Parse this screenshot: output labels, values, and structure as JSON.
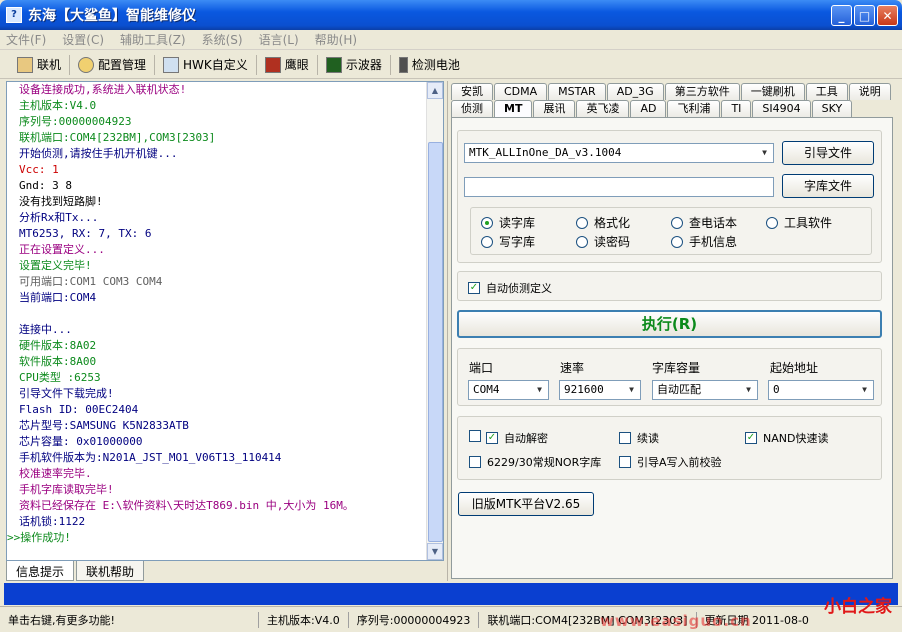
{
  "window": {
    "title": "东海【大鲨鱼】智能维修仪"
  },
  "menu": [
    "文件(F)",
    "设置(C)",
    "辅助工具(Z)",
    "系统(S)",
    "语言(L)",
    "帮助(H)"
  ],
  "toolbar": [
    "联机",
    "配置管理",
    "HWK自定义",
    "鹰眼",
    "示波器",
    "检测电池"
  ],
  "log": [
    {
      "t": "设备连接成功,系统进入联机状态!",
      "c": "#9a0080"
    },
    {
      "t": "主机版本:V4.0",
      "c": "#0c8a1c"
    },
    {
      "t": "序列号:00000004923",
      "c": "#0c8a1c"
    },
    {
      "t": "联机端口:COM4[232BM],COM3[2303]",
      "c": "#0c8a1c"
    },
    {
      "t": "开始侦测,请按住手机开机键...",
      "c": "#000080"
    },
    {
      "t": "Vcc: 1",
      "c": "#cc0000"
    },
    {
      "t": "Gnd: 3 8",
      "c": "#000000"
    },
    {
      "t": "没有找到短路脚!",
      "c": "#000000"
    },
    {
      "t": "分析Rx和Tx...",
      "c": "#000080"
    },
    {
      "t": "MT6253, RX: 7, TX: 6",
      "c": "#000080"
    },
    {
      "t": "正在设置定义...",
      "c": "#9a0080"
    },
    {
      "t": "设置定义完毕!",
      "c": "#0c8a1c"
    },
    {
      "t": "可用端口:COM1 COM3 COM4",
      "c": "#606060"
    },
    {
      "t": "当前端口:COM4",
      "c": "#000080"
    },
    {
      "t": "",
      "c": "#000000"
    },
    {
      "t": "连接中...",
      "c": "#000080"
    },
    {
      "t": "硬件版本:8A02",
      "c": "#0c8a1c"
    },
    {
      "t": "软件版本:8A00",
      "c": "#0c8a1c"
    },
    {
      "t": "CPU类型 :6253",
      "c": "#0c8a1c"
    },
    {
      "t": "引导文件下载完成!",
      "c": "#000080"
    },
    {
      "t": "Flash ID: 00EC2404",
      "c": "#000080"
    },
    {
      "t": "芯片型号:SAMSUNG K5N2833ATB",
      "c": "#000080"
    },
    {
      "t": "芯片容量: 0x01000000",
      "c": "#000080"
    },
    {
      "t": "手机软件版本为:N201A_JST_MO1_V06T13_110414",
      "c": "#000080"
    },
    {
      "t": "校准速率完毕.",
      "c": "#9a0080"
    },
    {
      "t": "手机字库读取完毕!",
      "c": "#9a0080"
    },
    {
      "t": "资料已经保存在 E:\\软件资料\\天时达T869.bin 中,大小为 16M。",
      "c": "#9a0080"
    },
    {
      "t": "话机锁:1122",
      "c": "#000080"
    },
    {
      "t": ">>操作成功!",
      "c": "#0c8a1c"
    }
  ],
  "bottom_tabs": [
    "信息提示",
    "联机帮助"
  ],
  "right_tabs_row1": [
    "安凯",
    "CDMA",
    "MSTAR",
    "AD_3G",
    "第三方软件",
    "一键刷机",
    "工具",
    "说明"
  ],
  "right_tabs_row2": [
    "侦测",
    "MT",
    "展讯",
    "英飞凌",
    "AD",
    "飞利浦",
    "TI",
    "SI4904",
    "SKY"
  ],
  "mt": {
    "da_file": "MTK_ALLInOne_DA_v3.1004",
    "boot_btn": "引导文件",
    "flash_path": "",
    "flash_btn": "字库文件",
    "options": [
      "读字库",
      "格式化",
      "查电话本",
      "工具软件",
      "写字库",
      "读密码",
      "手机信息"
    ],
    "auto_detect": "自动侦测定义",
    "exec": "执行(R)",
    "port_label": "端口",
    "port": "COM4",
    "baud_label": "速率",
    "baud": "921600",
    "size_label": "字库容量",
    "size": "自动匹配",
    "addr_label": "起始地址",
    "addr": "0",
    "auto_decrypt": "自动解密",
    "resume": "续读",
    "nand_fast": "NAND快速读",
    "nor_6229": "6229/30常规NOR字库",
    "boot_verify": "引导A写入前校验",
    "old_platform": "旧版MTK平台V2.65"
  },
  "status": {
    "hint": "单击右键,有更多功能!",
    "host_ver": "主机版本:V4.0",
    "serial": "序列号:00000004923",
    "port": "联机端口:COM4[232BM] COM3[2303]",
    "update": "更新日期 2011-08-0"
  },
  "watermark": {
    "site": "小白之家",
    "url": "www.easiguo.cn"
  }
}
